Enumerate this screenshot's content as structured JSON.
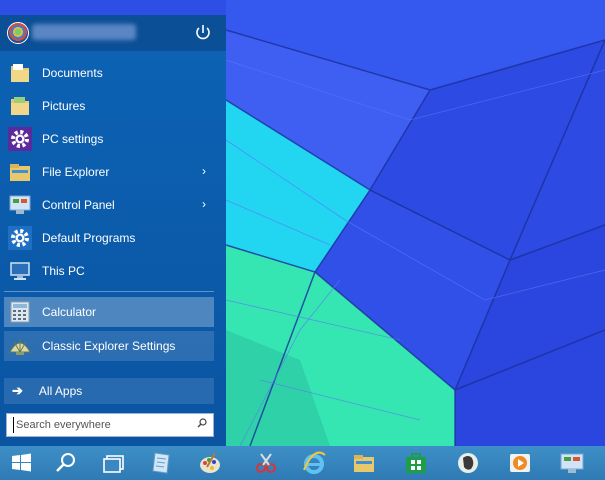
{
  "start_menu": {
    "power_icon": "power-icon",
    "items": [
      {
        "label": "Documents",
        "icon": "documents-folder-icon"
      },
      {
        "label": "Pictures",
        "icon": "pictures-folder-icon"
      },
      {
        "label": "PC settings",
        "icon": "pc-settings-gear-icon"
      },
      {
        "label": "File Explorer",
        "icon": "file-explorer-icon",
        "arrow": "›"
      },
      {
        "label": "Control Panel",
        "icon": "control-panel-icon",
        "arrow": "›"
      },
      {
        "label": "Default Programs",
        "icon": "default-programs-gear-icon"
      },
      {
        "label": "This PC",
        "icon": "this-pc-icon"
      },
      {
        "label": "Calculator",
        "icon": "calculator-icon"
      },
      {
        "label": "Classic Explorer Settings",
        "icon": "classic-shell-icon"
      }
    ],
    "all_apps": {
      "label": "All Apps",
      "arrow": "➔"
    },
    "search": {
      "placeholder": "Search everywhere"
    }
  },
  "taskbar": {
    "buttons": [
      "windows-start-icon",
      "search-icon",
      "task-view-icon",
      "notepad-icon",
      "paint-icon",
      "snipping-tool-icon",
      "internet-explorer-icon",
      "file-explorer-icon",
      "store-icon",
      "evernote-icon",
      "media-player-icon",
      "control-panel-icon"
    ]
  },
  "colors": {
    "start_menu_bg": "#0d63b5",
    "taskbar_bg": "#3e8fc7",
    "wallpaper_blue": "#2f4fe0",
    "wallpaper_cyan": "#25d4f0",
    "wallpaper_green": "#36e8b4"
  }
}
